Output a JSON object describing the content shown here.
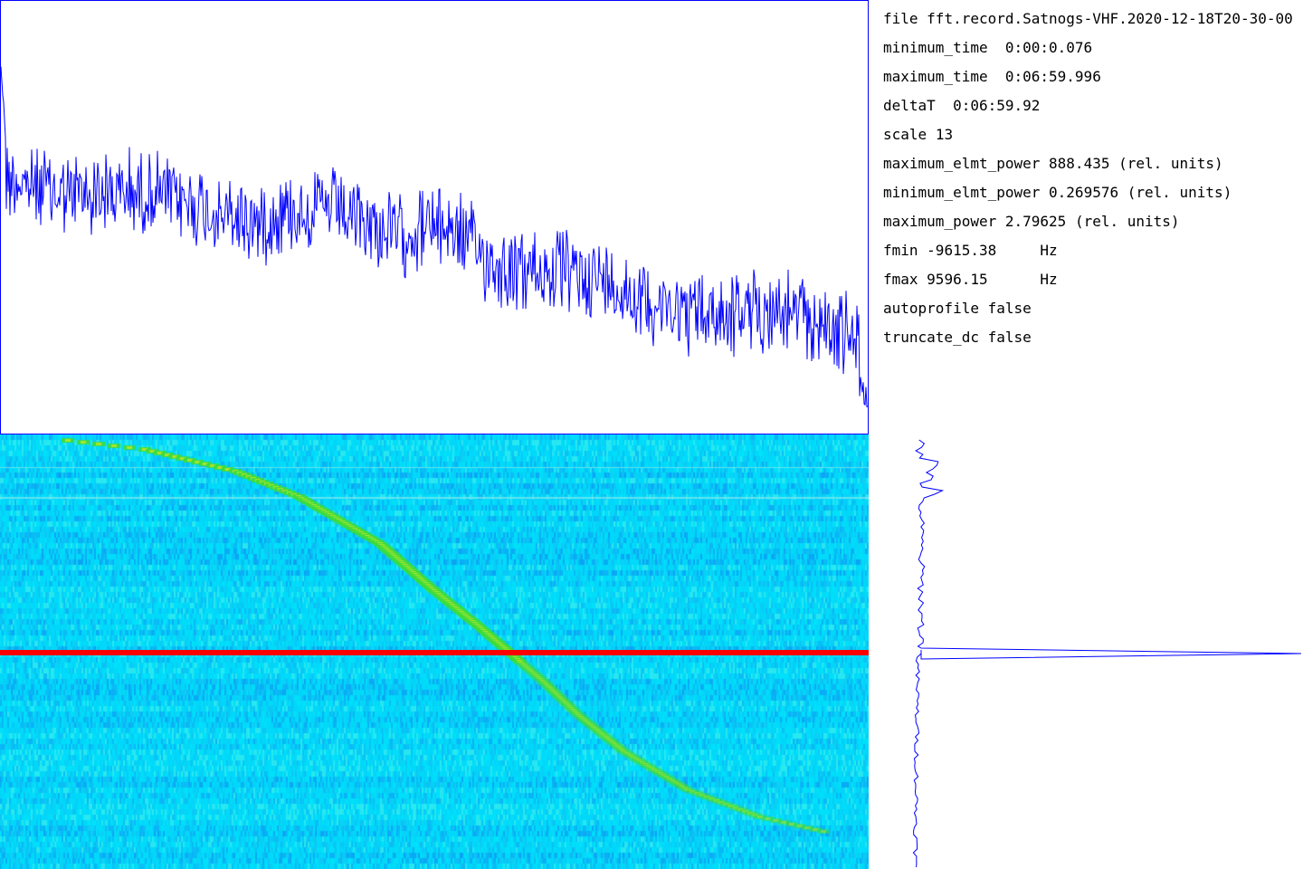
{
  "info": [
    {
      "key": "file",
      "value": "fft.record.Satnogs-VHF.2020-12-18T20-30-00"
    },
    {
      "key": "minimum_time",
      "value": "0:00:0.076"
    },
    {
      "key": "maximum_time",
      "value": "0:06:59.996"
    },
    {
      "key": "deltaT",
      "value": "0:06:59.92"
    },
    {
      "key": "scale",
      "value": "13"
    },
    {
      "key": "maximum_elmt_power",
      "value": "888.435 (rel. units)"
    },
    {
      "key": "minimum_elmt_power",
      "value": "0.269576 (rel. units)"
    },
    {
      "key": "maximum_power",
      "value": "2.79625 (rel. units)"
    },
    {
      "key": "fmin",
      "value": "-9615.38     Hz"
    },
    {
      "key": "fmax",
      "value": "9596.15      Hz"
    },
    {
      "key": "autoprofile",
      "value": "false"
    },
    {
      "key": "truncate_dc",
      "value": "false"
    }
  ],
  "colors": {
    "trace": "#0000ff",
    "waterfall_background": "#00bfff",
    "signal": "#22dd22",
    "cursor": "#ff0000"
  }
}
